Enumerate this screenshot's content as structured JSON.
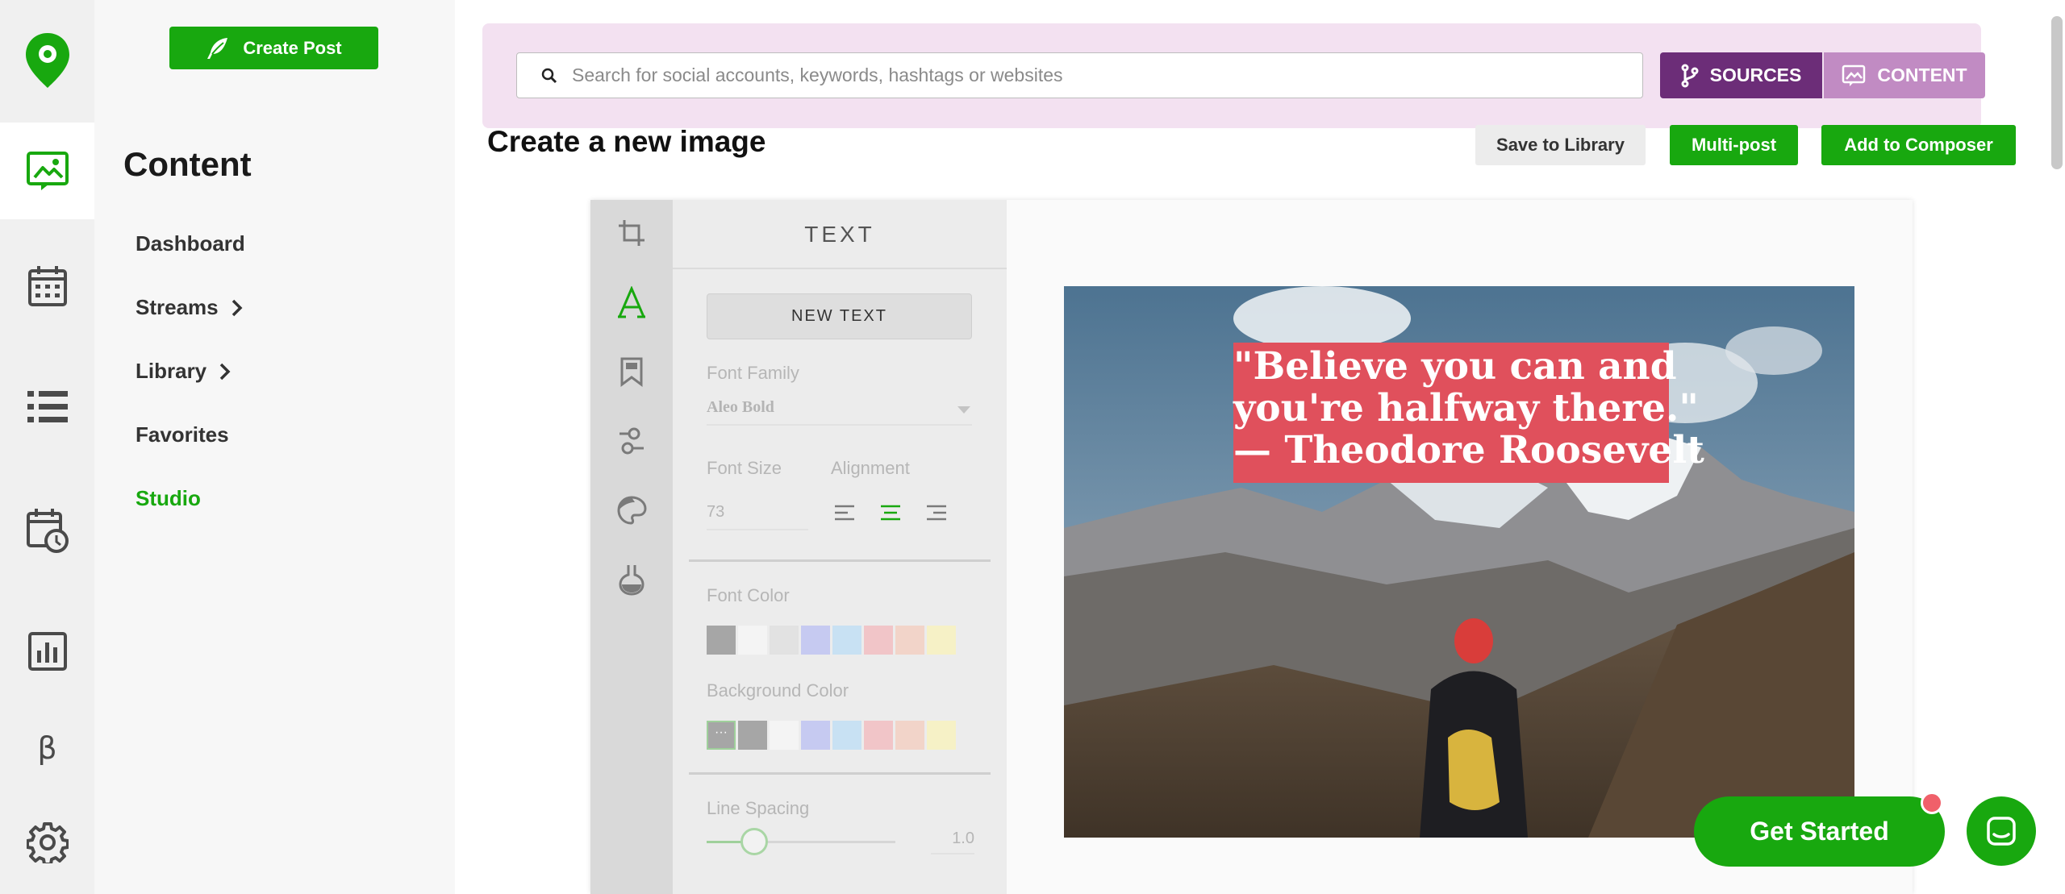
{
  "rail": {
    "items": [
      {
        "name": "logo-icon"
      },
      {
        "name": "content-icon",
        "active": true
      },
      {
        "name": "calendar-icon"
      },
      {
        "name": "list-icon"
      },
      {
        "name": "schedule-icon"
      },
      {
        "name": "analytics-icon"
      },
      {
        "name": "beta-icon",
        "label": "β"
      },
      {
        "name": "gear-icon"
      }
    ]
  },
  "subnav": {
    "create_post": "Create Post",
    "title": "Content",
    "items": [
      {
        "label": "Dashboard",
        "has_arrow": false
      },
      {
        "label": "Streams",
        "has_arrow": true
      },
      {
        "label": "Library",
        "has_arrow": true
      },
      {
        "label": "Favorites",
        "has_arrow": false
      },
      {
        "label": "Studio",
        "has_arrow": false,
        "active": true
      }
    ]
  },
  "search": {
    "placeholder": "Search for social accounts, keywords, hashtags or websites",
    "sources_label": "SOURCES",
    "content_label": "CONTENT"
  },
  "header": {
    "title": "Create a new image",
    "save_label": "Save to Library",
    "multipost_label": "Multi-post",
    "add_label": "Add to Composer"
  },
  "editor": {
    "tools": [
      "crop-icon",
      "text-icon",
      "bookmark-icon",
      "adjust-icon",
      "palette-icon",
      "flask-icon"
    ],
    "panel_title": "TEXT",
    "new_text": "NEW TEXT",
    "font_family_label": "Font Family",
    "font_family_value": "Aleo Bold",
    "font_size_label": "Font Size",
    "font_size_value": "73",
    "alignment_label": "Alignment",
    "alignment_selected": "center",
    "font_color_label": "Font Color",
    "font_colors": [
      "#a6a6a6",
      "#f4f4f4",
      "#e2e2e2",
      "#c6caf1",
      "#c8e1f3",
      "#f1c5c8",
      "#f2d4c9",
      "#f6f1c6"
    ],
    "bg_color_label": "Background Color",
    "bg_colors": [
      "more",
      "#a6a6a6",
      "#f4f4f4",
      "#c6caf1",
      "#c8e1f3",
      "#f1c5c8",
      "#f2d4c9",
      "#f6f1c6"
    ],
    "line_spacing_label": "Line Spacing",
    "line_spacing_value": "1.0",
    "line_spacing_fraction": 0.25
  },
  "canvas": {
    "quote_lines": [
      "\"Believe you can and",
      "you're halfway there.\"",
      "— Theodore Roosevelt"
    ],
    "quote_bg": "#e0505c"
  },
  "floating": {
    "get_started": "Get Started"
  },
  "colors": {
    "accent_green": "#18a80f",
    "sources_purple": "#6c2d78",
    "content_purple": "#c18bc3",
    "search_panel_bg": "#f3e1f1"
  }
}
